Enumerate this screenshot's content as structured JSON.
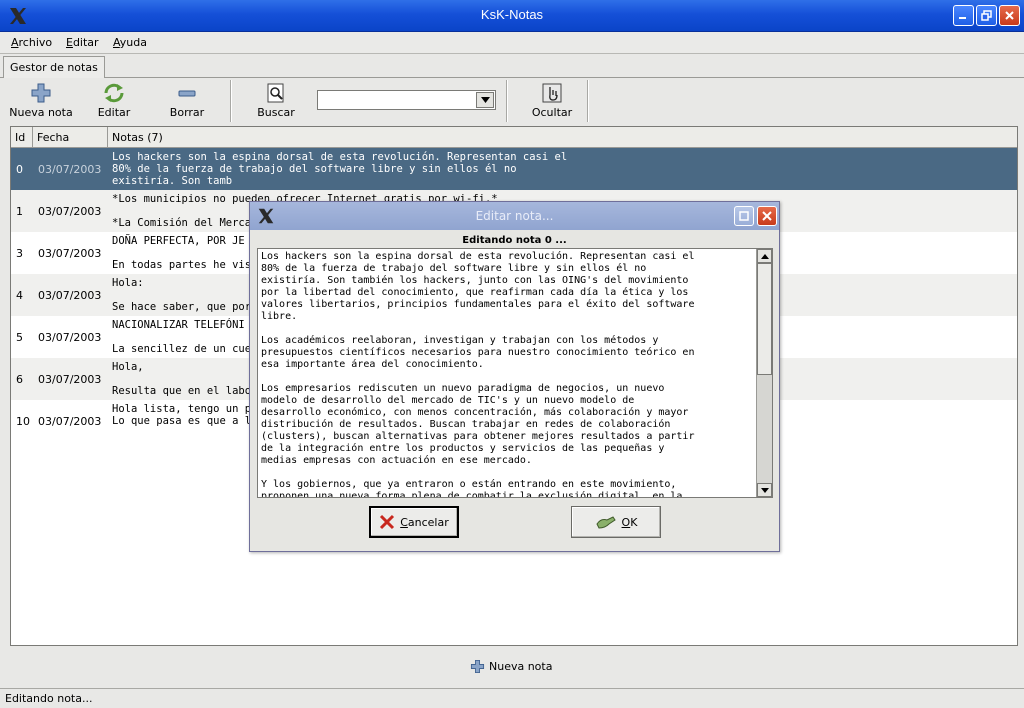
{
  "window": {
    "title": "KsK-Notas"
  },
  "menu": [
    {
      "label": "Archivo",
      "mnemonic": "A",
      "rest": "rchivo"
    },
    {
      "label": "Editar",
      "mnemonic": "E",
      "rest": "ditar"
    },
    {
      "label": "Ayuda",
      "mnemonic": "A",
      "rest": "yuda"
    }
  ],
  "tab": {
    "label": "Gestor de notas"
  },
  "toolbar": {
    "new_label": "Nueva nota",
    "edit_label": "Editar",
    "delete_label": "Borrar",
    "search_label": "Buscar",
    "search_value": "",
    "hide_label": "Ocultar"
  },
  "table": {
    "col_id": "Id",
    "col_date": "Fecha",
    "col_notes": "Notas (7)",
    "rows": [
      {
        "id": "0",
        "date": "03/07/2003",
        "note": "Los hackers son la espina dorsal de esta revolución. Representan casi el\n80% de la fuerza de trabajo del software libre y sin ellos él no\nexistiría. Son tamb"
      },
      {
        "id": "1",
        "date": "03/07/2003",
        "note": "*Los municipios no pueden ofrecer Internet gratis por wi-fi.*\n\n*La Comisión del Mercado"
      },
      {
        "id": "3",
        "date": "03/07/2003",
        "note": "DOÑA PERFECTA, POR JE\n\nEn todas partes he visto/"
      },
      {
        "id": "4",
        "date": "03/07/2003",
        "note": "Hola:\n\nSe hace saber, que por l"
      },
      {
        "id": "5",
        "date": "03/07/2003",
        "note": "NACIONALIZAR TELEFÓNI\n\nLa sencillez de un cuento"
      },
      {
        "id": "6",
        "date": "03/07/2003",
        "note": "Hola,\n\nResulta que en el labora"
      },
      {
        "id": "10",
        "date": "03/07/2003",
        "note": "Hola lista, tengo un prob\nLo que pasa es que a la"
      }
    ]
  },
  "bottom": {
    "new_label": "Nueva nota"
  },
  "status": {
    "text": "Editando nota..."
  },
  "dialog": {
    "title": "Editar nota...",
    "heading": "Editando nota 0 ...",
    "text": "Los hackers son la espina dorsal de esta revolución. Representan casi el\n80% de la fuerza de trabajo del software libre y sin ellos él no\nexistiría. Son también los hackers, junto con las OING's del movimiento\npor la libertad del conocimiento, que reafirman cada día la ética y los\nvalores libertarios, principios fundamentales para el éxito del software\nlibre.\n\nLos académicos reelaboran, investigan y trabajan con los métodos y\npresupuestos científicos necesarios para nuestro conocimiento teórico en\nesa importante área del conocimiento.\n\nLos empresarios rediscuten un nuevo paradigma de negocios, un nuevo\nmodelo de desarrollo del mercado de TIC's y un nuevo modelo de\ndesarrollo económico, con menos concentración, más colaboración y mayor\ndistribución de resultados. Buscan trabajar en redes de colaboración\n(clusters), buscan alternativas para obtener mejores resultados a partir\nde la integración entre los productos y servicios de las pequeñas y\nmedias empresas con actuación en ese mercado.\n\nY los gobiernos, que ya entraron o están entrando en este movimiento,\nproponen una nueva forma plena de combatir la exclusión digital, en la",
    "cancel_mnemonic": "C",
    "cancel_rest": "ancelar",
    "ok_mnemonic": "O",
    "ok_rest": "K"
  },
  "colors": {
    "selection": "#4a6984",
    "titlebar": "#1550d8"
  }
}
